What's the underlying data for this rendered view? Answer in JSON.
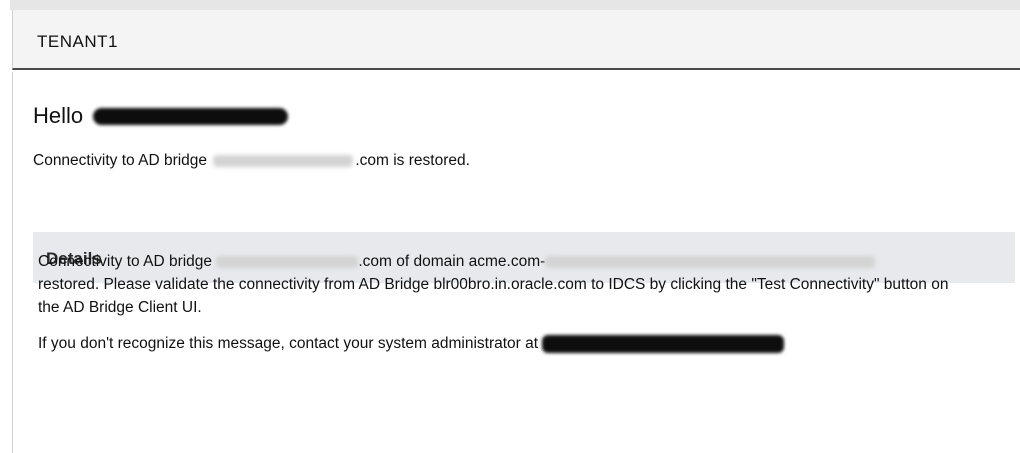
{
  "header": {
    "tenant": "TENANT1"
  },
  "greeting": {
    "hello": "Hello"
  },
  "status": {
    "prefix": "Connectivity to AD bridge ",
    "suffix": ".com is restored."
  },
  "details": {
    "title": "Details",
    "para1_prefix": "Connectivity to AD bridge ",
    "para1_mid": ".com of domain acme.com-",
    "para1_rest": "restored. Please validate the connectivity from AD Bridge blr00bro.in.oracle.com to IDCS by clicking the \"Test Connectivity\" button on the AD Bridge Client UI.",
    "para2_prefix": "If you don't recognize this message, contact your system administrator at "
  },
  "colors": {
    "header_bg": "#f4f4f4",
    "details_bg": "#e7e9ed",
    "redaction_dark": "#0d0d0d",
    "redaction_light": "#d3d3d3"
  }
}
